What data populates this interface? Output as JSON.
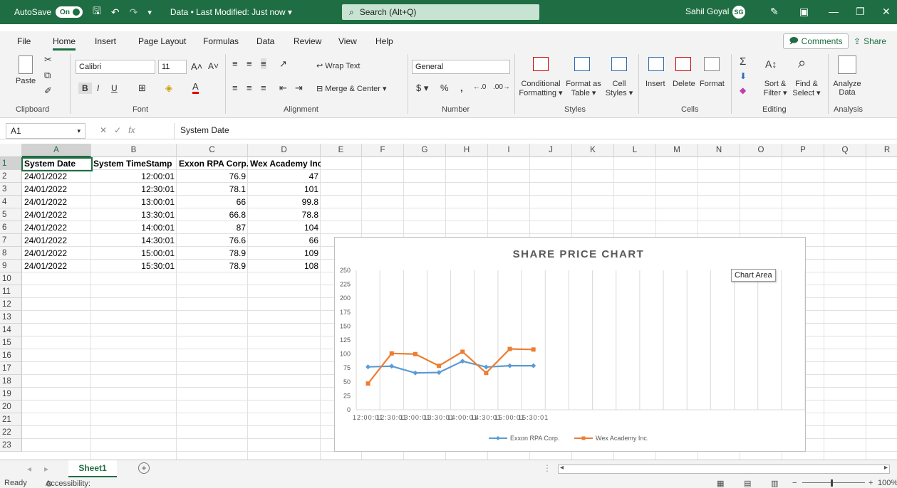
{
  "titlebar": {
    "autosave_label": "AutoSave",
    "autosave_state": "On",
    "doc_title": "Data",
    "modified": "• Last Modified: Just now",
    "search_placeholder": "Search (Alt+Q)",
    "user_name": "Sahil Goyal",
    "user_initials": "SG"
  },
  "menu": {
    "tabs": [
      "File",
      "Home",
      "Insert",
      "Page Layout",
      "Formulas",
      "Data",
      "Review",
      "View",
      "Help"
    ],
    "active_tab": "Home",
    "comments": "Comments",
    "share": "Share"
  },
  "ribbon": {
    "groups": [
      "Clipboard",
      "Font",
      "Alignment",
      "Number",
      "Styles",
      "Cells",
      "Editing",
      "Analysis"
    ],
    "paste": "Paste",
    "font_name": "Calibri",
    "font_size": "11",
    "wrap_text": "Wrap Text",
    "merge_center": "Merge & Center",
    "number_format": "General",
    "conditional_formatting": [
      "Conditional",
      "Formatting"
    ],
    "format_as_table": [
      "Format as",
      "Table"
    ],
    "cell_styles": [
      "Cell",
      "Styles"
    ],
    "insert": "Insert",
    "delete": "Delete",
    "format": "Format",
    "sort_filter": [
      "Sort &",
      "Filter"
    ],
    "find_select": [
      "Find &",
      "Select"
    ],
    "analyze_data": [
      "Analyze",
      "Data"
    ]
  },
  "formula_bar": {
    "name_box": "A1",
    "content": "System Date"
  },
  "grid": {
    "columns": [
      "A",
      "B",
      "C",
      "D",
      "E",
      "F",
      "G",
      "H",
      "I",
      "J",
      "K",
      "L",
      "M",
      "N",
      "O",
      "P",
      "Q",
      "R"
    ],
    "rows": [
      "1",
      "2",
      "3",
      "4",
      "5",
      "6",
      "7",
      "8",
      "9",
      "10",
      "11",
      "12",
      "13",
      "14",
      "15",
      "16",
      "17",
      "18",
      "19",
      "20",
      "21",
      "22",
      "23"
    ],
    "header": [
      "System Date",
      "System TimeStamp",
      "Exxon RPA Corp.",
      "Wex Academy Inc."
    ],
    "data": [
      [
        "24/01/2022",
        "12:00:01",
        "76.9",
        "47"
      ],
      [
        "24/01/2022",
        "12:30:01",
        "78.1",
        "101"
      ],
      [
        "24/01/2022",
        "13:00:01",
        "66",
        "99.8"
      ],
      [
        "24/01/2022",
        "13:30:01",
        "66.8",
        "78.8"
      ],
      [
        "24/01/2022",
        "14:00:01",
        "87",
        "104"
      ],
      [
        "24/01/2022",
        "14:30:01",
        "76.6",
        "66"
      ],
      [
        "24/01/2022",
        "15:00:01",
        "78.9",
        "109"
      ],
      [
        "24/01/2022",
        "15:30:01",
        "78.9",
        "108"
      ]
    ]
  },
  "chart_data": {
    "type": "line",
    "title": "SHARE PRICE CHART",
    "categories": [
      "12:00:01",
      "12:30:01",
      "13:00:01",
      "13:30:01",
      "14:00:01",
      "14:30:01",
      "15:00:01",
      "15:30:01"
    ],
    "series": [
      {
        "name": "Exxon RPA Corp.",
        "values": [
          76.9,
          78.1,
          66,
          66.8,
          87,
          76.6,
          78.9,
          78.9
        ],
        "color": "#5b9bd5",
        "marker": "diamond"
      },
      {
        "name": "Wex Academy Inc.",
        "values": [
          47,
          101,
          99.8,
          78.8,
          104,
          66,
          109,
          108
        ],
        "color": "#ed7d31",
        "marker": "square"
      }
    ],
    "ylim": [
      0,
      250
    ],
    "yticks": [
      0,
      25,
      50,
      75,
      100,
      125,
      150,
      175,
      200,
      225,
      250
    ],
    "grid": "vertical",
    "legend": "bottom",
    "category_slots": 19,
    "tooltip": "Chart Area"
  },
  "sheets": {
    "tabs": [
      "Sheet1"
    ],
    "active": "Sheet1"
  },
  "status": {
    "ready": "Ready",
    "accessibility": "Accessibility: Investigate",
    "zoom": "100%"
  },
  "colors": {
    "excel_green": "#1f6e43",
    "exxon_blue": "#5b9bd5",
    "wex_orange": "#ed7d31"
  }
}
